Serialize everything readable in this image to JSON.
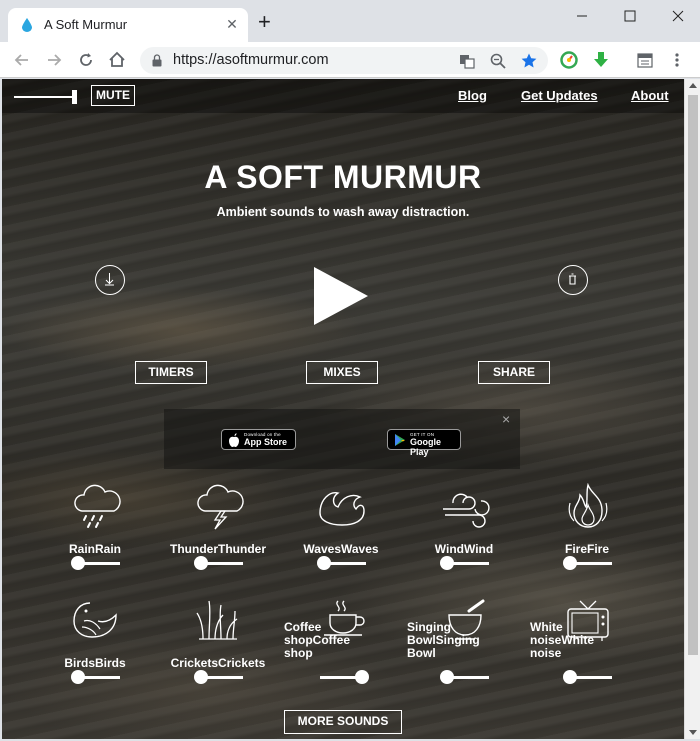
{
  "browser": {
    "tab_title": "A Soft Murmur",
    "url": "https://asoftmurmur.com"
  },
  "nav": {
    "mute_label": "MUTE",
    "links": [
      "Blog",
      "Get Updates",
      "About"
    ],
    "volume": 1.0
  },
  "hero": {
    "title": "A SOFT MURMUR",
    "tagline": "Ambient sounds to wash away distraction."
  },
  "actions": {
    "timers": "TIMERS",
    "mixes": "MIXES",
    "share": "SHARE"
  },
  "ad": {
    "appstore_small": "Download on the",
    "appstore_big": "App Store",
    "googleplay_small": "GET IT ON",
    "googleplay_big": "Google Play",
    "close": "×"
  },
  "sounds": [
    {
      "label": "RainRain",
      "icon": "rain-icon",
      "volume": 0.0
    },
    {
      "label": "ThunderThunder",
      "icon": "thunder-icon",
      "volume": 0.0
    },
    {
      "label": "WavesWaves",
      "icon": "waves-icon",
      "volume": 0.0
    },
    {
      "label": "WindWind",
      "icon": "wind-icon",
      "volume": 0.0
    },
    {
      "label": "FireFire",
      "icon": "fire-icon",
      "volume": 0.0
    },
    {
      "label": "BirdsBirds",
      "icon": "birds-icon",
      "volume": 0.0
    },
    {
      "label": "CricketsCrickets",
      "icon": "crickets-icon",
      "volume": 0.0
    },
    {
      "label": "Coffee shopCoffee shop",
      "icon": "coffee-icon",
      "volume": 1.0
    },
    {
      "label": "Singing BowlSinging Bowl",
      "icon": "singing-bowl-icon",
      "volume": 0.0
    },
    {
      "label": "White noiseWhite noise",
      "icon": "tv-icon",
      "volume": 0.0
    }
  ],
  "more_sounds": "MORE SOUNDS",
  "colors": {
    "text": "#ffffff",
    "chrome_bg": "#dee1e6",
    "bookmark_star": "#1a73e8"
  }
}
